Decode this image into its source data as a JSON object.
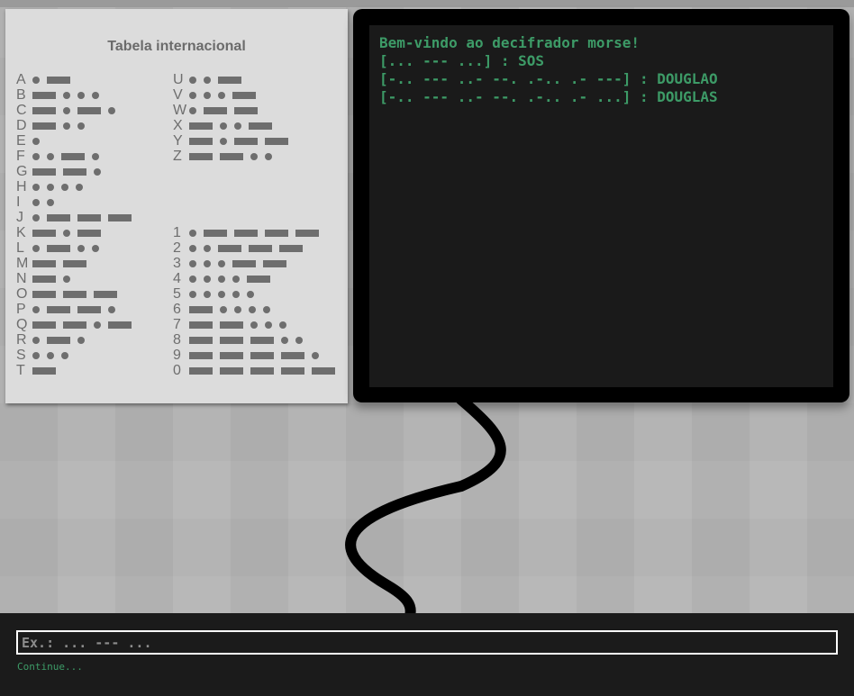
{
  "morse_table": {
    "title": "Tabela internacional",
    "left_column": [
      {
        "char": "A",
        "code": ".-"
      },
      {
        "char": "B",
        "code": "-..."
      },
      {
        "char": "C",
        "code": "-.-."
      },
      {
        "char": "D",
        "code": "-.."
      },
      {
        "char": "E",
        "code": "."
      },
      {
        "char": "F",
        "code": "..-."
      },
      {
        "char": "G",
        "code": "--."
      },
      {
        "char": "H",
        "code": "...."
      },
      {
        "char": "I",
        "code": ".."
      },
      {
        "char": "J",
        "code": ".---"
      },
      {
        "char": "K",
        "code": "-.-"
      },
      {
        "char": "L",
        "code": ".-.."
      },
      {
        "char": "M",
        "code": "--"
      },
      {
        "char": "N",
        "code": "-."
      },
      {
        "char": "O",
        "code": "---"
      },
      {
        "char": "P",
        "code": ".--."
      },
      {
        "char": "Q",
        "code": "--.-"
      },
      {
        "char": "R",
        "code": ".-."
      },
      {
        "char": "S",
        "code": "..."
      },
      {
        "char": "T",
        "code": "-"
      }
    ],
    "right_letters": [
      {
        "char": "U",
        "code": "..-"
      },
      {
        "char": "V",
        "code": "...-"
      },
      {
        "char": "W",
        "code": ".--"
      },
      {
        "char": "X",
        "code": "-..-"
      },
      {
        "char": "Y",
        "code": "-.--"
      },
      {
        "char": "Z",
        "code": "--.."
      }
    ],
    "right_digits": [
      {
        "char": "1",
        "code": ".----"
      },
      {
        "char": "2",
        "code": "..---"
      },
      {
        "char": "3",
        "code": "...--"
      },
      {
        "char": "4",
        "code": "....-"
      },
      {
        "char": "5",
        "code": "....."
      },
      {
        "char": "6",
        "code": "-...."
      },
      {
        "char": "7",
        "code": "--..."
      },
      {
        "char": "8",
        "code": "---.."
      },
      {
        "char": "9",
        "code": "----."
      },
      {
        "char": "0",
        "code": "-----"
      }
    ]
  },
  "terminal": {
    "lines": [
      "Bem-vindo ao decifrador morse!",
      "[... --- ...] : SOS",
      "[-.. --- ..- --. .-.. .- ---] : DOUGLAO",
      "[-.. --- ..- --. .-.. .- ...] : DOUGLAS"
    ]
  },
  "console": {
    "input_value": "",
    "placeholder": "Ex.: ... --- ...",
    "status": "Continue..."
  },
  "colors": {
    "terminal_text": "#3d9b67",
    "symbol": "#6e6e6e"
  }
}
